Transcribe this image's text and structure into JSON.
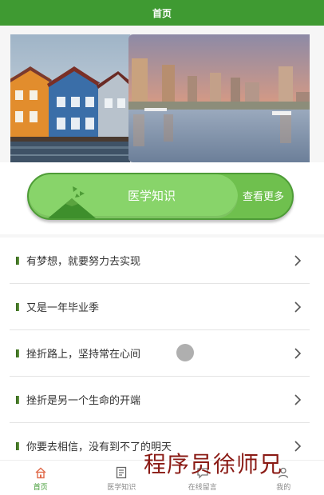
{
  "header": {
    "title": "首页"
  },
  "banner": {
    "active_index": 0,
    "slide_count": 3
  },
  "feature": {
    "label": "医学知识",
    "more_label": "查看更多"
  },
  "list": {
    "items": [
      {
        "text": "有梦想，就要努力去实现"
      },
      {
        "text": "又是一年毕业季"
      },
      {
        "text": "挫折路上，坚持常在心间"
      },
      {
        "text": "挫折是另一个生命的开端"
      },
      {
        "text": "你要去相信，没有到不了的明天"
      }
    ]
  },
  "tabbar": {
    "tabs": [
      {
        "label": "首页",
        "icon": "home-icon",
        "active": true
      },
      {
        "label": "医学知识",
        "icon": "document-icon",
        "active": false
      },
      {
        "label": "在线留言",
        "icon": "chat-icon",
        "active": false
      },
      {
        "label": "我的",
        "icon": "user-icon",
        "active": false
      }
    ]
  },
  "watermark": {
    "text": "程序员徐师兄"
  },
  "colors": {
    "accent": "#3f9a32",
    "pill": "#88d46a"
  }
}
